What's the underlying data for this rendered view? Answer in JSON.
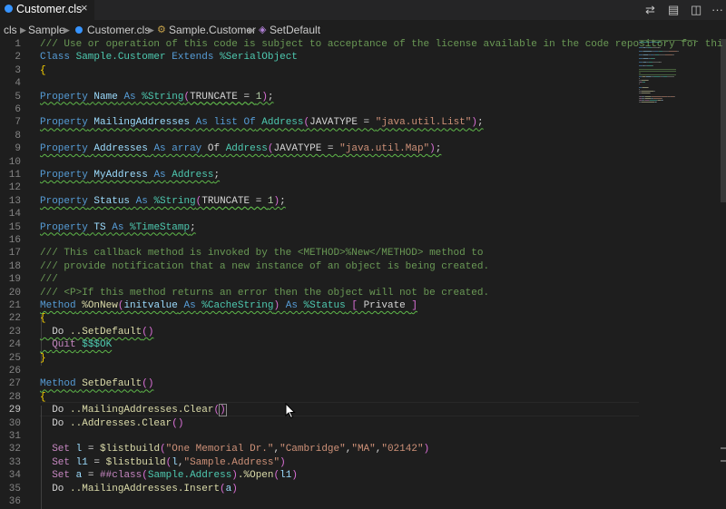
{
  "tab": {
    "label": "Customer.cls",
    "close_icon": "close-icon"
  },
  "actions": [
    {
      "name": "open-changes-icon",
      "glyph": "⇄"
    },
    {
      "name": "preview-icon",
      "glyph": "▤"
    },
    {
      "name": "split-editor-icon",
      "glyph": "◫"
    },
    {
      "name": "more-actions-icon",
      "glyph": "···"
    }
  ],
  "breadcrumb": {
    "items": [
      "cls",
      "Sample",
      "Customer.cls",
      "Sample.Customer",
      "SetDefault"
    ]
  },
  "editor": {
    "current_line": 29,
    "lines": [
      [
        [
          "/// Use or operation of this code is subject to acceptance of the license available in the code repository for thi",
          "c"
        ]
      ],
      [
        [
          "Class ",
          "k"
        ],
        [
          "Sample.Customer",
          "t"
        ],
        [
          " ",
          "p"
        ],
        [
          "Extends",
          "k"
        ],
        [
          " ",
          "p"
        ],
        [
          "%SerialObject",
          "t"
        ]
      ],
      [
        [
          "{",
          "b1"
        ]
      ],
      [],
      [
        [
          "Property",
          "k"
        ],
        [
          " ",
          "p"
        ],
        [
          "Name",
          "v"
        ],
        [
          " ",
          "p"
        ],
        [
          "As",
          "k"
        ],
        [
          " ",
          "p"
        ],
        [
          "%String",
          "t"
        ],
        [
          "(",
          "b2"
        ],
        [
          "TRUNCATE = ",
          "w"
        ],
        [
          "1",
          "n"
        ],
        [
          ")",
          "b2"
        ],
        [
          ";",
          "p"
        ]
      ],
      [],
      [
        [
          "Property",
          "k"
        ],
        [
          " ",
          "p"
        ],
        [
          "MailingAddresses",
          "v"
        ],
        [
          " ",
          "p"
        ],
        [
          "As",
          "k"
        ],
        [
          " ",
          "p"
        ],
        [
          "list Of",
          "k"
        ],
        [
          " ",
          "p"
        ],
        [
          "Address",
          "t"
        ],
        [
          "(",
          "b2"
        ],
        [
          "JAVATYPE = ",
          "p"
        ],
        [
          "\"java.util.List\"",
          "s"
        ],
        [
          ")",
          "b2"
        ],
        [
          ";",
          "p"
        ]
      ],
      [],
      [
        [
          "Property",
          "k"
        ],
        [
          " ",
          "p"
        ],
        [
          "Addresses",
          "v"
        ],
        [
          " ",
          "p"
        ],
        [
          "As",
          "k"
        ],
        [
          " ",
          "p"
        ],
        [
          "array",
          "k"
        ],
        [
          " Of ",
          "p"
        ],
        [
          "Address",
          "t"
        ],
        [
          "(",
          "b2"
        ],
        [
          "JAVATYPE = ",
          "p"
        ],
        [
          "\"java.util.Map\"",
          "s"
        ],
        [
          ")",
          "b2"
        ],
        [
          ";",
          "p"
        ]
      ],
      [],
      [
        [
          "Property",
          "k"
        ],
        [
          " ",
          "p"
        ],
        [
          "MyAddress",
          "v"
        ],
        [
          " ",
          "p"
        ],
        [
          "As",
          "k"
        ],
        [
          " ",
          "p"
        ],
        [
          "Address",
          "t"
        ],
        [
          ";",
          "p"
        ]
      ],
      [],
      [
        [
          "Property",
          "k"
        ],
        [
          " ",
          "p"
        ],
        [
          "Status",
          "v"
        ],
        [
          " ",
          "p"
        ],
        [
          "As",
          "k"
        ],
        [
          " ",
          "p"
        ],
        [
          "%String",
          "t"
        ],
        [
          "(",
          "b2"
        ],
        [
          "TRUNCATE = ",
          "w"
        ],
        [
          "1",
          "n"
        ],
        [
          ")",
          "b2"
        ],
        [
          ";",
          "p"
        ]
      ],
      [],
      [
        [
          "Property",
          "k"
        ],
        [
          " ",
          "p"
        ],
        [
          "TS",
          "v"
        ],
        [
          " ",
          "p"
        ],
        [
          "As",
          "k"
        ],
        [
          " ",
          "p"
        ],
        [
          "%TimeStamp",
          "t"
        ],
        [
          ";",
          "p"
        ]
      ],
      [],
      [
        [
          "/// This callback method is invoked by the <METHOD>%New</METHOD> method to",
          "c"
        ]
      ],
      [
        [
          "/// provide notification that a new instance of an object is being created.",
          "c"
        ]
      ],
      [
        [
          "///",
          "c"
        ]
      ],
      [
        [
          "/// <P>If this method returns an error then the object will not be created.",
          "c"
        ]
      ],
      [
        [
          "Method",
          "k"
        ],
        [
          " ",
          "p"
        ],
        [
          "%OnNew",
          "f"
        ],
        [
          "(",
          "b2"
        ],
        [
          "initvalue",
          "v"
        ],
        [
          " ",
          "p"
        ],
        [
          "As",
          "k"
        ],
        [
          " ",
          "p"
        ],
        [
          "%CacheString",
          "t"
        ],
        [
          ")",
          "b2"
        ],
        [
          " ",
          "p"
        ],
        [
          "As",
          "k"
        ],
        [
          " ",
          "p"
        ],
        [
          "%Status",
          "t"
        ],
        [
          " ",
          "p"
        ],
        [
          "[",
          "b2"
        ],
        [
          " Private ",
          "p"
        ],
        [
          "]",
          "b2"
        ]
      ],
      [
        [
          "{",
          "b1"
        ]
      ],
      [
        [
          "  Do ",
          "p"
        ],
        [
          "..SetDefault",
          "f"
        ],
        [
          "()",
          "b2"
        ]
      ],
      [
        [
          "  ",
          "p"
        ],
        [
          "Quit",
          "m"
        ],
        [
          " ",
          "p"
        ],
        [
          "$$$OK",
          "t"
        ]
      ],
      [
        [
          "}",
          "b1"
        ]
      ],
      [],
      [
        [
          "Method",
          "k"
        ],
        [
          " ",
          "p"
        ],
        [
          "SetDefault",
          "f"
        ],
        [
          "()",
          "b2"
        ]
      ],
      [
        [
          "{",
          "b1"
        ]
      ],
      [
        [
          "  Do ",
          "p"
        ],
        [
          "..MailingAddresses.Clear",
          "f"
        ],
        [
          "(",
          "b2"
        ],
        [
          ")",
          "b2h"
        ]
      ],
      [
        [
          "  Do ",
          "p"
        ],
        [
          "..Addresses.Clear",
          "f"
        ],
        [
          "()",
          "b2"
        ]
      ],
      [],
      [
        [
          "  ",
          "p"
        ],
        [
          "Set",
          "m"
        ],
        [
          " ",
          "p"
        ],
        [
          "l",
          "v"
        ],
        [
          " = ",
          "p"
        ],
        [
          "$listbuild",
          "f"
        ],
        [
          "(",
          "b2"
        ],
        [
          "\"One Memorial Dr.\"",
          "s"
        ],
        [
          ",",
          "p"
        ],
        [
          "\"Cambridge\"",
          "s"
        ],
        [
          ",",
          "p"
        ],
        [
          "\"MA\"",
          "s"
        ],
        [
          ",",
          "p"
        ],
        [
          "\"02142\"",
          "s"
        ],
        [
          ")",
          "b2"
        ]
      ],
      [
        [
          "  ",
          "p"
        ],
        [
          "Set",
          "m"
        ],
        [
          " ",
          "p"
        ],
        [
          "l1",
          "v"
        ],
        [
          " = ",
          "p"
        ],
        [
          "$listbuild",
          "f"
        ],
        [
          "(",
          "b2"
        ],
        [
          "l",
          "v"
        ],
        [
          ",",
          "p"
        ],
        [
          "\"Sample.Address\"",
          "s"
        ],
        [
          ")",
          "b2"
        ]
      ],
      [
        [
          "  ",
          "p"
        ],
        [
          "Set",
          "m"
        ],
        [
          " ",
          "p"
        ],
        [
          "a",
          "v"
        ],
        [
          " = ",
          "p"
        ],
        [
          "##class",
          "m"
        ],
        [
          "(",
          "b2"
        ],
        [
          "Sample.Address",
          "t"
        ],
        [
          ")",
          "b2"
        ],
        [
          ".%Open",
          "f"
        ],
        [
          "(",
          "b2"
        ],
        [
          "l1",
          "v"
        ],
        [
          ")",
          "b2"
        ]
      ],
      [
        [
          "  Do ",
          "p"
        ],
        [
          "..MailingAddresses.Insert",
          "f"
        ],
        [
          "(",
          "b2"
        ],
        [
          "a",
          "v"
        ],
        [
          ")",
          "b2"
        ]
      ],
      []
    ]
  },
  "colors": {
    "background": "#1e1e1e",
    "comment": "#6a9955",
    "keyword": "#569cd6",
    "type": "#4ec9b0",
    "function": "#dcdcaa",
    "string": "#ce9178",
    "variable": "#9cdcfe",
    "control": "#c586c0",
    "number": "#b5cea8",
    "squiggle": "#5fb84a"
  }
}
